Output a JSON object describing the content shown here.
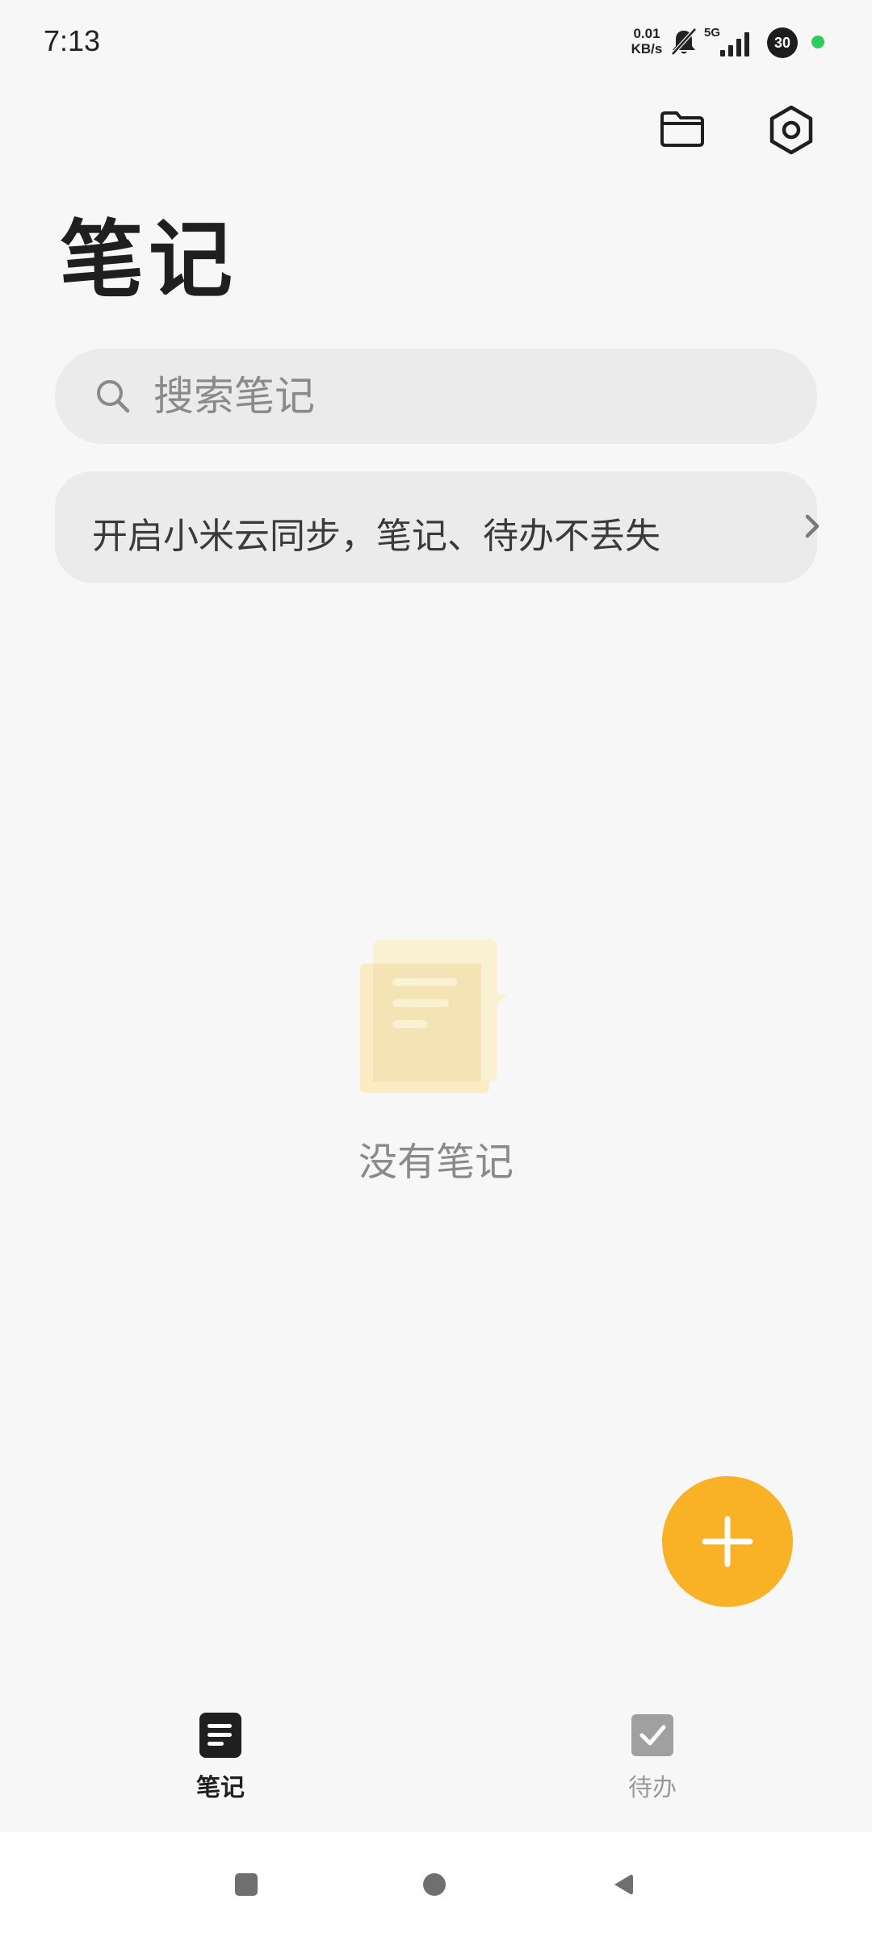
{
  "status_bar": {
    "time": "7:13",
    "net_speed_value": "0.01",
    "net_speed_unit": "KB/s",
    "network_type": "5G",
    "battery": "30",
    "icons": [
      "bell-off-icon",
      "signal-icon"
    ]
  },
  "header": {
    "actions": [
      "folder-icon",
      "settings-icon"
    ]
  },
  "page": {
    "title": "笔记"
  },
  "search": {
    "placeholder": "搜索笔记",
    "value": ""
  },
  "cloud_banner": {
    "text": "开启小米云同步，笔记、待办不丢失"
  },
  "empty_state": {
    "text": "没有笔记"
  },
  "fab": {
    "icon": "plus-icon",
    "color": "#f9b126"
  },
  "bottom_nav": {
    "tabs": [
      {
        "label": "笔记",
        "icon": "note-icon",
        "active": true
      },
      {
        "label": "待办",
        "icon": "checkbox-icon",
        "active": false
      }
    ]
  },
  "system_nav": {
    "buttons": [
      "recents-button",
      "home-button",
      "back-button"
    ]
  },
  "colors": {
    "background": "#f7f7f7",
    "accent": "#f9b126",
    "surface": "#ebebeb"
  }
}
